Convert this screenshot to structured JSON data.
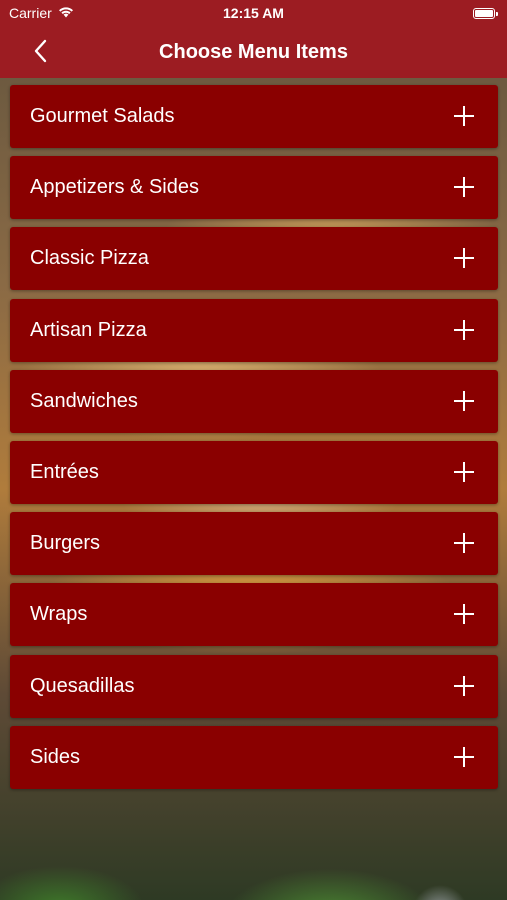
{
  "status_bar": {
    "carrier": "Carrier",
    "time": "12:15 AM",
    "icons": [
      "wifi-icon",
      "battery-icon"
    ]
  },
  "nav": {
    "title": "Choose Menu Items",
    "back_icon": "chevron-left-icon"
  },
  "menu": {
    "items": [
      {
        "label": "Gourmet Salads"
      },
      {
        "label": "Appetizers & Sides"
      },
      {
        "label": "Classic Pizza"
      },
      {
        "label": "Artisan Pizza"
      },
      {
        "label": "Sandwiches"
      },
      {
        "label": "Entrées"
      },
      {
        "label": "Burgers"
      },
      {
        "label": "Wraps"
      },
      {
        "label": "Quesadillas"
      },
      {
        "label": "Sides"
      }
    ],
    "expand_icon": "plus-icon"
  },
  "colors": {
    "header": "#9c1c22",
    "row": "#8a0000",
    "text": "#ffffff"
  }
}
